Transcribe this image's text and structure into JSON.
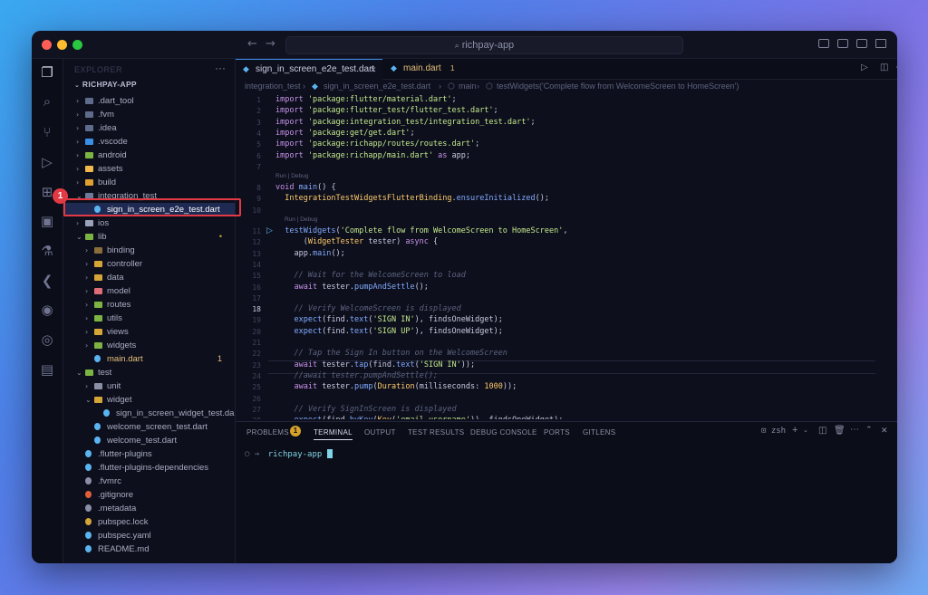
{
  "window": {
    "command_center": "richpay-app"
  },
  "sidebar": {
    "header": "EXPLORER",
    "root": "RICHPAY-APP",
    "items": [
      {
        "label": ".dart_tool",
        "type": "folder",
        "depth": 0,
        "open": false,
        "color": "#5f6b8a"
      },
      {
        "label": ".fvm",
        "type": "folder",
        "depth": 0,
        "open": false,
        "color": "#5f6b8a"
      },
      {
        "label": ".idea",
        "type": "folder",
        "depth": 0,
        "open": false,
        "color": "#5f6b8a"
      },
      {
        "label": ".vscode",
        "type": "folder",
        "depth": 0,
        "open": false,
        "color": "#3a8ee6"
      },
      {
        "label": "android",
        "type": "folder",
        "depth": 0,
        "open": false,
        "color": "#7cb342"
      },
      {
        "label": "assets",
        "type": "folder",
        "depth": 0,
        "open": false,
        "color": "#f2b84b"
      },
      {
        "label": "build",
        "type": "folder",
        "depth": 0,
        "open": false,
        "color": "#e0a030"
      },
      {
        "label": "integration_test",
        "type": "folder",
        "depth": 0,
        "open": true,
        "color": "#6b7a99"
      },
      {
        "label": "sign_in_screen_e2e_test.dart",
        "type": "file",
        "depth": 1,
        "selected": true,
        "color": "#5ab4f0"
      },
      {
        "label": "ios",
        "type": "folder",
        "depth": 0,
        "open": false,
        "color": "#9aa2b8"
      },
      {
        "label": "lib",
        "type": "folder",
        "depth": 0,
        "open": true,
        "color": "#7cb342",
        "mark": "•"
      },
      {
        "label": "binding",
        "type": "folder",
        "depth": 1,
        "open": false,
        "color": "#8a6d3b"
      },
      {
        "label": "controller",
        "type": "folder",
        "depth": 1,
        "open": false,
        "color": "#d4a537"
      },
      {
        "label": "data",
        "type": "folder",
        "depth": 1,
        "open": false,
        "color": "#d4a537"
      },
      {
        "label": "model",
        "type": "folder",
        "depth": 1,
        "open": false,
        "color": "#e06c75"
      },
      {
        "label": "routes",
        "type": "folder",
        "depth": 1,
        "open": false,
        "color": "#7cb342"
      },
      {
        "label": "utils",
        "type": "folder",
        "depth": 1,
        "open": false,
        "color": "#7cb342"
      },
      {
        "label": "views",
        "type": "folder",
        "depth": 1,
        "open": false,
        "color": "#d4a537"
      },
      {
        "label": "widgets",
        "type": "folder",
        "depth": 1,
        "open": false,
        "color": "#7cb342"
      },
      {
        "label": "main.dart",
        "type": "file",
        "depth": 1,
        "color": "#5ab4f0",
        "mark": "1",
        "labelColor": "#e6c07b"
      },
      {
        "label": "test",
        "type": "folder",
        "depth": 0,
        "open": true,
        "color": "#7cb342"
      },
      {
        "label": "unit",
        "type": "folder",
        "depth": 1,
        "open": false,
        "color": "#8a8fa6"
      },
      {
        "label": "widget",
        "type": "folder",
        "depth": 1,
        "open": true,
        "color": "#d4a537"
      },
      {
        "label": "sign_in_screen_widget_test.dart",
        "type": "file",
        "depth": 2,
        "color": "#5ab4f0"
      },
      {
        "label": "welcome_screen_test.dart",
        "type": "file",
        "depth": 1,
        "color": "#5ab4f0"
      },
      {
        "label": "welcome_test.dart",
        "type": "file",
        "depth": 1,
        "color": "#5ab4f0"
      },
      {
        "label": ".flutter-plugins",
        "type": "file",
        "depth": 0,
        "color": "#5ab4f0"
      },
      {
        "label": ".flutter-plugins-dependencies",
        "type": "file",
        "depth": 0,
        "color": "#5ab4f0"
      },
      {
        "label": ".fvmrc",
        "type": "file",
        "depth": 0,
        "color": "#8a8fa6"
      },
      {
        "label": ".gitignore",
        "type": "file",
        "depth": 0,
        "color": "#e05d3a"
      },
      {
        "label": ".metadata",
        "type": "file",
        "depth": 0,
        "color": "#8a8fa6"
      },
      {
        "label": "pubspec.lock",
        "type": "file",
        "depth": 0,
        "color": "#d4a537"
      },
      {
        "label": "pubspec.yaml",
        "type": "file",
        "depth": 0,
        "color": "#5ab4f0"
      },
      {
        "label": "README.md",
        "type": "file",
        "depth": 0,
        "color": "#5ab4f0"
      }
    ]
  },
  "editor": {
    "tabs": [
      {
        "label": "sign_in_screen_e2e_test.dart",
        "active": true
      },
      {
        "label": "main.dart",
        "badge": "1",
        "active": false
      }
    ],
    "breadcrumb": [
      "integration_test",
      "sign_in_screen_e2e_test.dart",
      "main",
      "testWidgets('Complete flow from WelcomeScreen to HomeScreen')"
    ],
    "codelens": "Run | Debug",
    "lines": [
      {
        "n": "1",
        "html": "<span class='k'>import</span> <span class='s'>'package:flutter/material.dart'</span>;"
      },
      {
        "n": "2",
        "html": "<span class='k'>import</span> <span class='s'>'package:flutter_test/flutter_test.dart'</span>;"
      },
      {
        "n": "3",
        "html": "<span class='k'>import</span> <span class='s'>'package:integration_test/integration_test.dart'</span>;"
      },
      {
        "n": "4",
        "html": "<span class='k'>import</span> <span class='s'>'package:get/get.dart'</span>;"
      },
      {
        "n": "5",
        "html": "<span class='k'>import</span> <span class='s'>'package:richapp/routes/routes.dart'</span>;"
      },
      {
        "n": "6",
        "html": "<span class='k'>import</span> <span class='s'>'package:richapp/main.dart'</span> <span class='k'>as</span> app;"
      },
      {
        "n": "7",
        "html": ""
      },
      {
        "n": "8",
        "html": "<span class='k'>void</span> <span class='f'>main</span>() {"
      },
      {
        "n": "9",
        "html": "  <span class='t'>IntegrationTestWidgetsFlutterBinding</span>.<span class='f'>ensureInitialized</span>();"
      },
      {
        "n": "10",
        "html": ""
      },
      {
        "n": "11",
        "html": "  <span class='f'>testWidgets</span>(<span class='s'>'Complete flow from WelcomeScreen to HomeScreen'</span>,"
      },
      {
        "n": "12",
        "html": "      (<span class='t'>WidgetTester</span> tester) <span class='k'>async</span> {"
      },
      {
        "n": "13",
        "html": "    app.<span class='f'>main</span>();"
      },
      {
        "n": "14",
        "html": ""
      },
      {
        "n": "15",
        "html": "    <span class='c'>// Wait for the WelcomeScreen to load</span>"
      },
      {
        "n": "16",
        "html": "    <span class='k'>await</span> tester.<span class='f'>pumpAndSettle</span>();"
      },
      {
        "n": "17",
        "html": ""
      },
      {
        "n": "18",
        "html": "    <span class='c'>// Verify WelcomeScreen is displayed</span>"
      },
      {
        "n": "19",
        "html": "    <span class='f'>expect</span>(find.<span class='f'>text</span>(<span class='s'>'SIGN IN'</span>), findsOneWidget);"
      },
      {
        "n": "20",
        "html": "    <span class='f'>expect</span>(find.<span class='f'>text</span>(<span class='s'>'SIGN UP'</span>), findsOneWidget);"
      },
      {
        "n": "21",
        "html": ""
      },
      {
        "n": "22",
        "html": "    <span class='c'>// Tap the Sign In button on the WelcomeScreen</span>"
      },
      {
        "n": "23",
        "html": "    <span class='k'>await</span> tester.<span class='f'>tap</span>(find.<span class='f'>text</span>(<span class='s'>'SIGN IN'</span>));"
      },
      {
        "n": "24",
        "html": "    <span class='c'>//await tester.pumpAndSettle();</span>"
      },
      {
        "n": "25",
        "html": "    <span class='k'>await</span> tester.<span class='f'>pump</span>(<span class='t'>Duration</span>(milliseconds: <span class='t'>1000</span>));"
      },
      {
        "n": "26",
        "html": ""
      },
      {
        "n": "27",
        "html": "    <span class='c'>// Verify SignInScreen is displayed</span>"
      },
      {
        "n": "28",
        "html": "    <span class='f'>expect</span>(find.<span class='f'>byKey</span>(<span class='t'>Key</span>(<span class='s'>'email_username'</span>)), findsOneWidget);"
      }
    ]
  },
  "panel": {
    "tabs": [
      {
        "label": "PROBLEMS",
        "badge": "1"
      },
      {
        "label": "TERMINAL",
        "active": true
      },
      {
        "label": "OUTPUT"
      },
      {
        "label": "TEST RESULTS"
      },
      {
        "label": "DEBUG CONSOLE"
      },
      {
        "label": "PORTS"
      },
      {
        "label": "GITLENS"
      }
    ],
    "shell": "zsh",
    "prompt_symbol": "○ →",
    "prompt_dir": "richpay-app"
  },
  "annotation": {
    "number": "1"
  }
}
